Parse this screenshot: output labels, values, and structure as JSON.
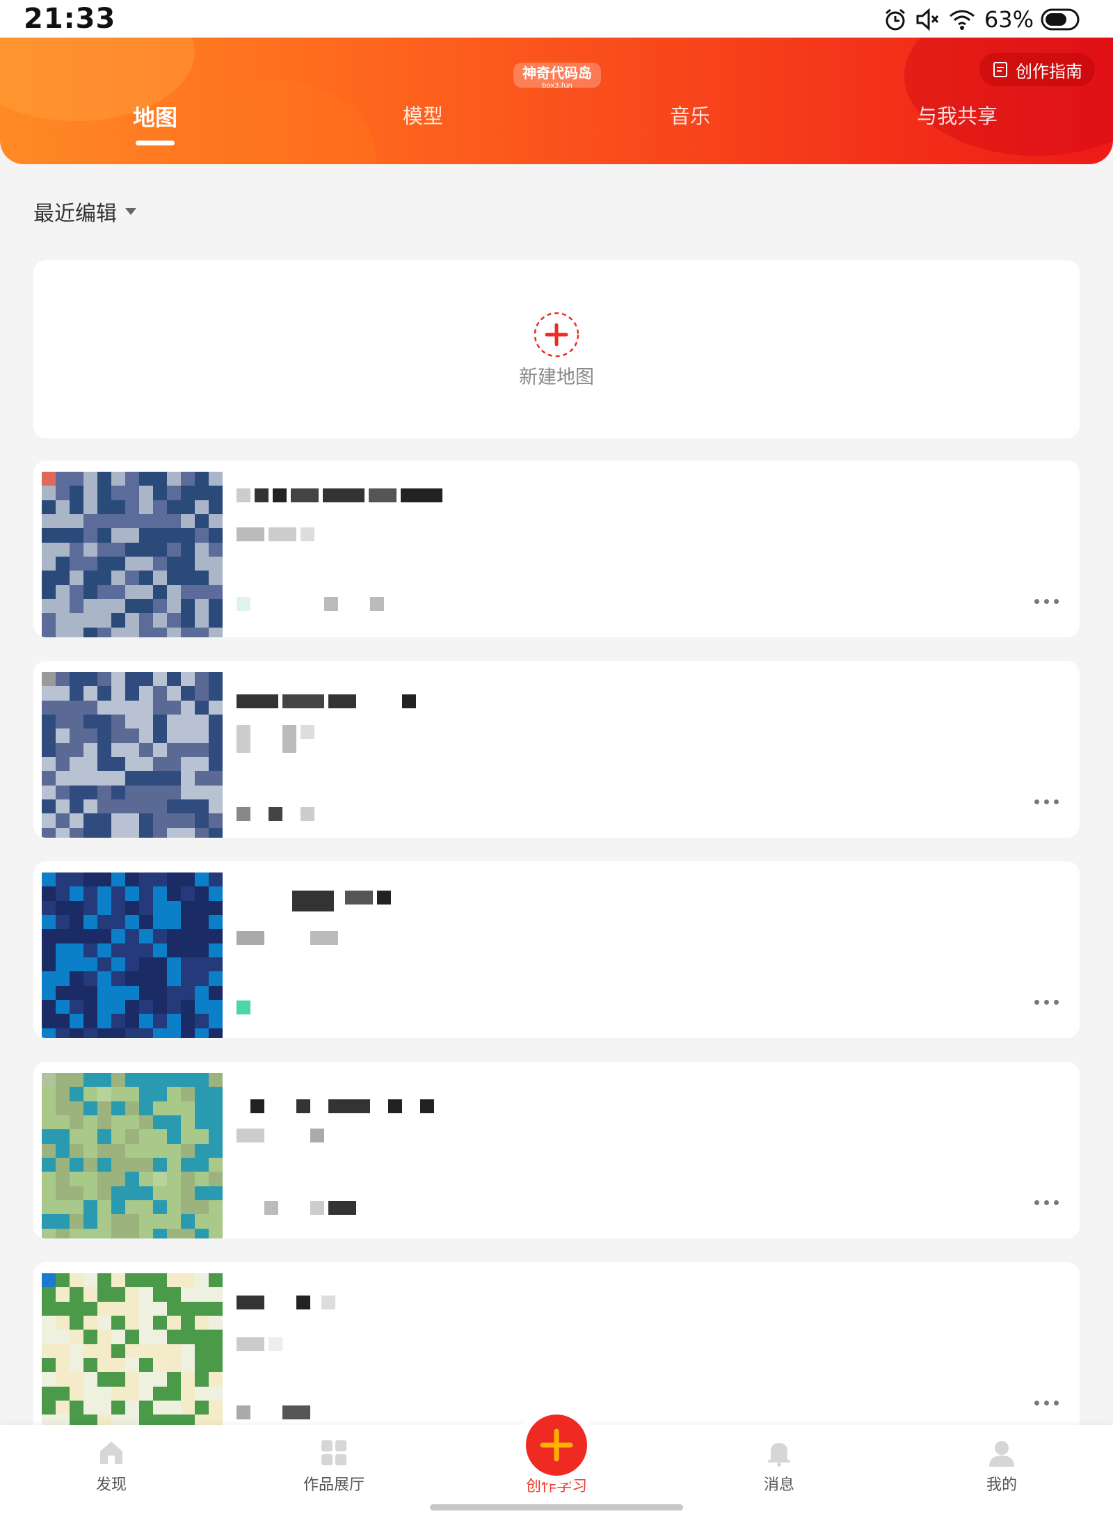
{
  "status_bar": {
    "time": "21:33",
    "battery": "63%",
    "icons": [
      "alarm-icon",
      "mute-icon",
      "wifi-icon",
      "battery-icon"
    ]
  },
  "header": {
    "logo_text": "神奇代码岛",
    "logo_sub": "box3.fun",
    "guide_label": "创作指南",
    "tabs": [
      {
        "label": "地图",
        "active": true
      },
      {
        "label": "模型",
        "active": false
      },
      {
        "label": "音乐",
        "active": false
      },
      {
        "label": "与我共享",
        "active": false
      }
    ]
  },
  "filter": {
    "label": "最近编辑"
  },
  "new_card": {
    "label": "新建地图"
  },
  "colors": {
    "accent": "#ee2a22",
    "header_start": "#ff8a24",
    "header_end": "#ee1a17"
  },
  "bottom_nav": {
    "items": [
      {
        "label": "发现",
        "icon": "home-icon"
      },
      {
        "label": "作品展厅",
        "icon": "grid-icon"
      },
      {
        "label": "创作学习",
        "icon": "plus-icon",
        "active": true
      },
      {
        "label": "消息",
        "icon": "bell-icon"
      },
      {
        "label": "我的",
        "icon": "user-icon"
      }
    ]
  }
}
